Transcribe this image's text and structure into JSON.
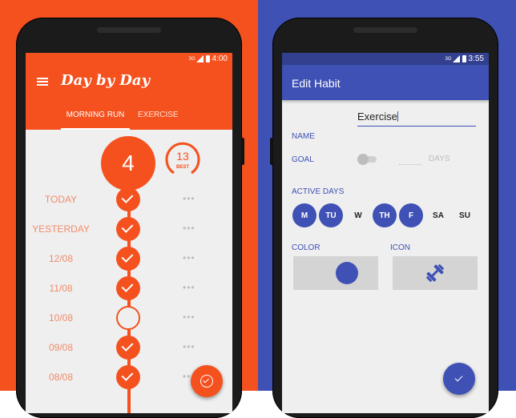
{
  "colors": {
    "left_bg": "#f4511e",
    "right_bg": "#3f51b5",
    "accent_orange": "#f4511e",
    "accent_indigo": "#3f51b5"
  },
  "left_phone": {
    "status": {
      "time": "4:00",
      "network": "3G"
    },
    "app_logo": "Day by Day",
    "tabs": [
      {
        "label": "MORNING RUN",
        "selected": true
      },
      {
        "label": "EXERCISE",
        "selected": false
      }
    ],
    "current_streak": "4",
    "best_streak": {
      "value": "13",
      "label": "BEST"
    },
    "days": [
      {
        "label": "TODAY",
        "done": true
      },
      {
        "label": "YESTERDAY",
        "done": true
      },
      {
        "label": "12/08",
        "done": true
      },
      {
        "label": "11/08",
        "done": true
      },
      {
        "label": "10/08",
        "done": false
      },
      {
        "label": "09/08",
        "done": true
      },
      {
        "label": "08/08",
        "done": true
      }
    ],
    "more_icon": "dots-icon",
    "fab_icon": "check-circle-icon"
  },
  "right_phone": {
    "status": {
      "time": "3:55",
      "network": "3G"
    },
    "title": "Edit Habit",
    "name_label": "NAME",
    "name_value": "Exercise",
    "goal_label": "GOAL",
    "goal_unit": "DAYS",
    "active_days_label": "ACTIVE DAYS",
    "days": [
      {
        "label": "M",
        "active": true
      },
      {
        "label": "TU",
        "active": true
      },
      {
        "label": "W",
        "active": false
      },
      {
        "label": "TH",
        "active": true
      },
      {
        "label": "F",
        "active": true
      },
      {
        "label": "SA",
        "active": false
      },
      {
        "label": "SU",
        "active": false
      }
    ],
    "color_label": "COLOR",
    "icon_label": "ICON",
    "selected_icon": "dumbbell-icon",
    "fab_icon": "check-icon"
  }
}
